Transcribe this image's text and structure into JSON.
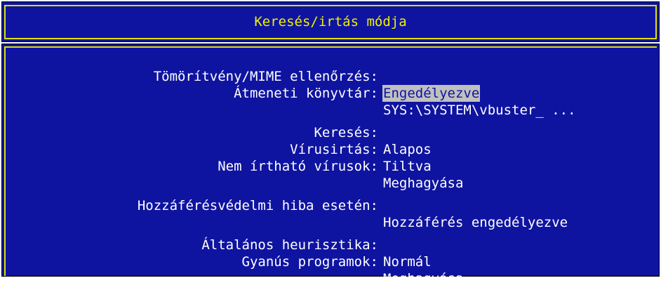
{
  "window": {
    "title": "Keresés/irtás módja"
  },
  "settings": [
    {
      "label": "Tömörítvény/MIME ellenőrzés:",
      "value": "Engedélyezve",
      "selected": true
    },
    {
      "label": "Átmeneti könyvtár:",
      "value": "SYS:\\SYSTEM\\vbuster_ ...",
      "selected": false
    },
    {
      "label": "Keresés:",
      "value": "Alapos",
      "selected": false
    },
    {
      "label": "Vírusirtás:",
      "value": "Tiltva",
      "selected": false
    },
    {
      "label": "Nem írtható vírusok:",
      "value": "Meghagyása",
      "selected": false
    },
    {
      "label": "Hozzáférésvédelmi hiba esetén:",
      "value": "Hozzáférés engedélyezve",
      "selected": false
    },
    {
      "label": "Általános heurisztika:",
      "value": "Normál",
      "selected": false
    },
    {
      "label": "Gyanús programok:",
      "value": "Meghagyása",
      "selected": false
    }
  ],
  "colors": {
    "background": "#0f14a0",
    "border": "#e0e000",
    "title_text": "#f0f000",
    "text": "#ffffff",
    "selection_bg": "#c0c0c0"
  }
}
